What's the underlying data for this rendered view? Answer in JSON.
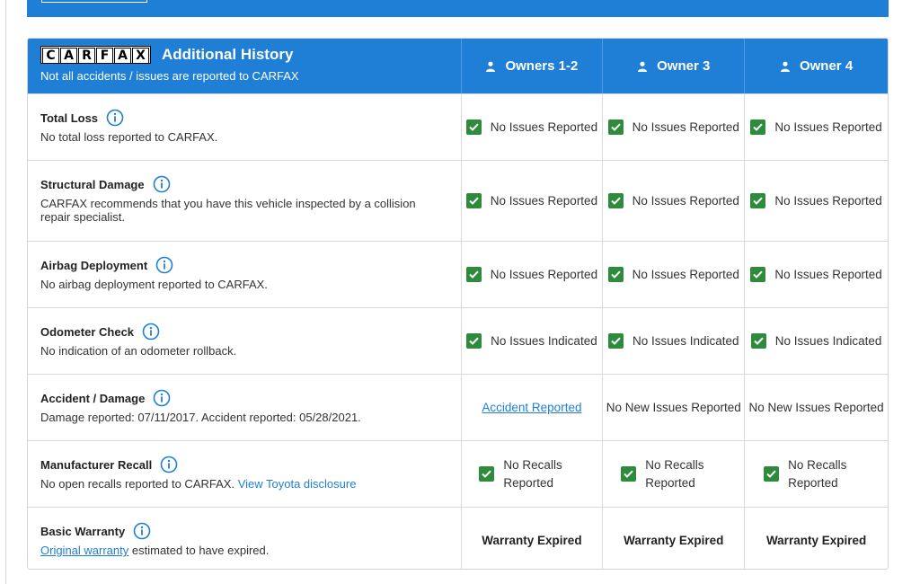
{
  "header": {
    "logo_letters": [
      "C",
      "A",
      "R",
      "F",
      "A",
      "X"
    ],
    "title": "Additional History",
    "subtitle": "Not all accidents / issues are reported to CARFAX",
    "owners": [
      "Owners 1-2",
      "Owner 3",
      "Owner 4"
    ]
  },
  "rows": [
    {
      "title": "Total Loss",
      "description": "No total loss reported to CARFAX.",
      "statuses": [
        "No Issues Reported",
        "No Issues Reported",
        "No Issues Reported"
      ]
    },
    {
      "title": "Structural Damage",
      "description": "CARFAX recommends that you have this vehicle inspected by a collision repair specialist.",
      "statuses": [
        "No Issues Reported",
        "No Issues Reported",
        "No Issues Reported"
      ]
    },
    {
      "title": "Airbag Deployment",
      "description": "No airbag deployment reported to CARFAX.",
      "statuses": [
        "No Issues Reported",
        "No Issues Reported",
        "No Issues Reported"
      ]
    },
    {
      "title": "Odometer Check",
      "description": "No indication of an odometer rollback.",
      "statuses": [
        "No Issues Indicated",
        "No Issues Indicated",
        "No Issues Indicated"
      ]
    },
    {
      "title": "Accident / Damage",
      "description": "Damage reported: 07/11/2017. Accident reported: 05/28/2021.",
      "statuses": [
        "Accident Reported",
        "No New Issues Reported",
        "No New Issues Reported"
      ]
    },
    {
      "title": "Manufacturer Recall",
      "description": "No open recalls reported to CARFAX.",
      "link": "View Toyota disclosure",
      "statuses": [
        "No Recalls Reported",
        "No Recalls Reported",
        "No Recalls Reported"
      ]
    },
    {
      "title": "Basic Warranty",
      "link": "Original warranty",
      "description": "estimated to have expired.",
      "statuses": [
        "Warranty Expired",
        "Warranty Expired",
        "Warranty Expired"
      ]
    }
  ],
  "icons": {
    "check": "checkbox-checked-icon",
    "info": "info-circle-icon",
    "person": "person-icon"
  },
  "colors": {
    "brand_blue": "#1f7fd6",
    "check_green": "#2e8b3c"
  }
}
